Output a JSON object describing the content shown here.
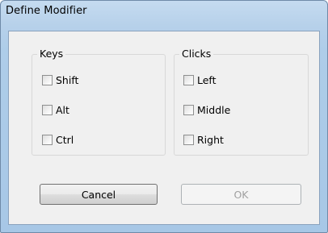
{
  "window": {
    "title": "Define Modifier"
  },
  "keys_group": {
    "label": "Keys",
    "items": [
      {
        "label": "Shift",
        "checked": false
      },
      {
        "label": "Alt",
        "checked": false
      },
      {
        "label": "Ctrl",
        "checked": false
      }
    ]
  },
  "clicks_group": {
    "label": "Clicks",
    "items": [
      {
        "label": "Left",
        "checked": false
      },
      {
        "label": "Middle",
        "checked": false
      },
      {
        "label": "Right",
        "checked": false
      }
    ]
  },
  "buttons": {
    "cancel_label": "Cancel",
    "ok_label": "OK",
    "ok_enabled": false
  },
  "colors": {
    "titlebar": "#b7d1ea",
    "client_background": "#f0f0f0",
    "disabled_text": "#a0a0a0"
  }
}
